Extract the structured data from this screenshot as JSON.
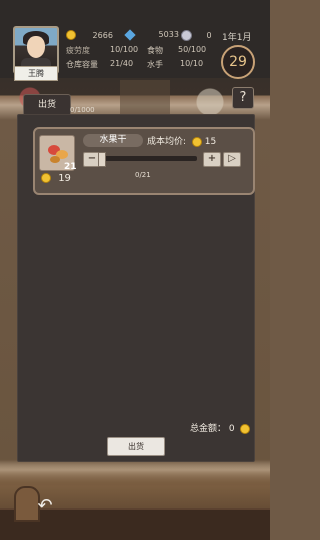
{
  "hud": {
    "player_name": "王腾",
    "gold": "2666",
    "gems": "5033",
    "tokens": "0",
    "date": "1年1月",
    "day": "29",
    "fatigue_label": "疲劳度",
    "fatigue_value": "10/100",
    "food_label": "食物",
    "food_value": "50/100",
    "storage_label": "仓库容量",
    "storage_value": "21/40",
    "sailor_label": "水手",
    "sailor_value": "10/10"
  },
  "tabs": {
    "sell_tab": "出货",
    "capacity_text": "0/1000",
    "help": "?"
  },
  "goods": {
    "name": "水果干",
    "stock": "21",
    "held_gold": "19",
    "avg_cost_label": "成本均价:",
    "avg_cost_value": "15",
    "minus": "−",
    "plus": "+",
    "max": "▷",
    "quantity": "0/21",
    "quantity_fraction": 0
  },
  "footer": {
    "total_label": "总金额：",
    "total_value": "0",
    "sell_button": "出货"
  },
  "icons": {
    "coin": "coin-icon",
    "gem": "gem-icon",
    "token": "token-icon",
    "back": "back-arrow-icon"
  },
  "colors": {
    "accent": "#c8a277",
    "panel": "#3b3533",
    "card": "#5b4f46"
  }
}
